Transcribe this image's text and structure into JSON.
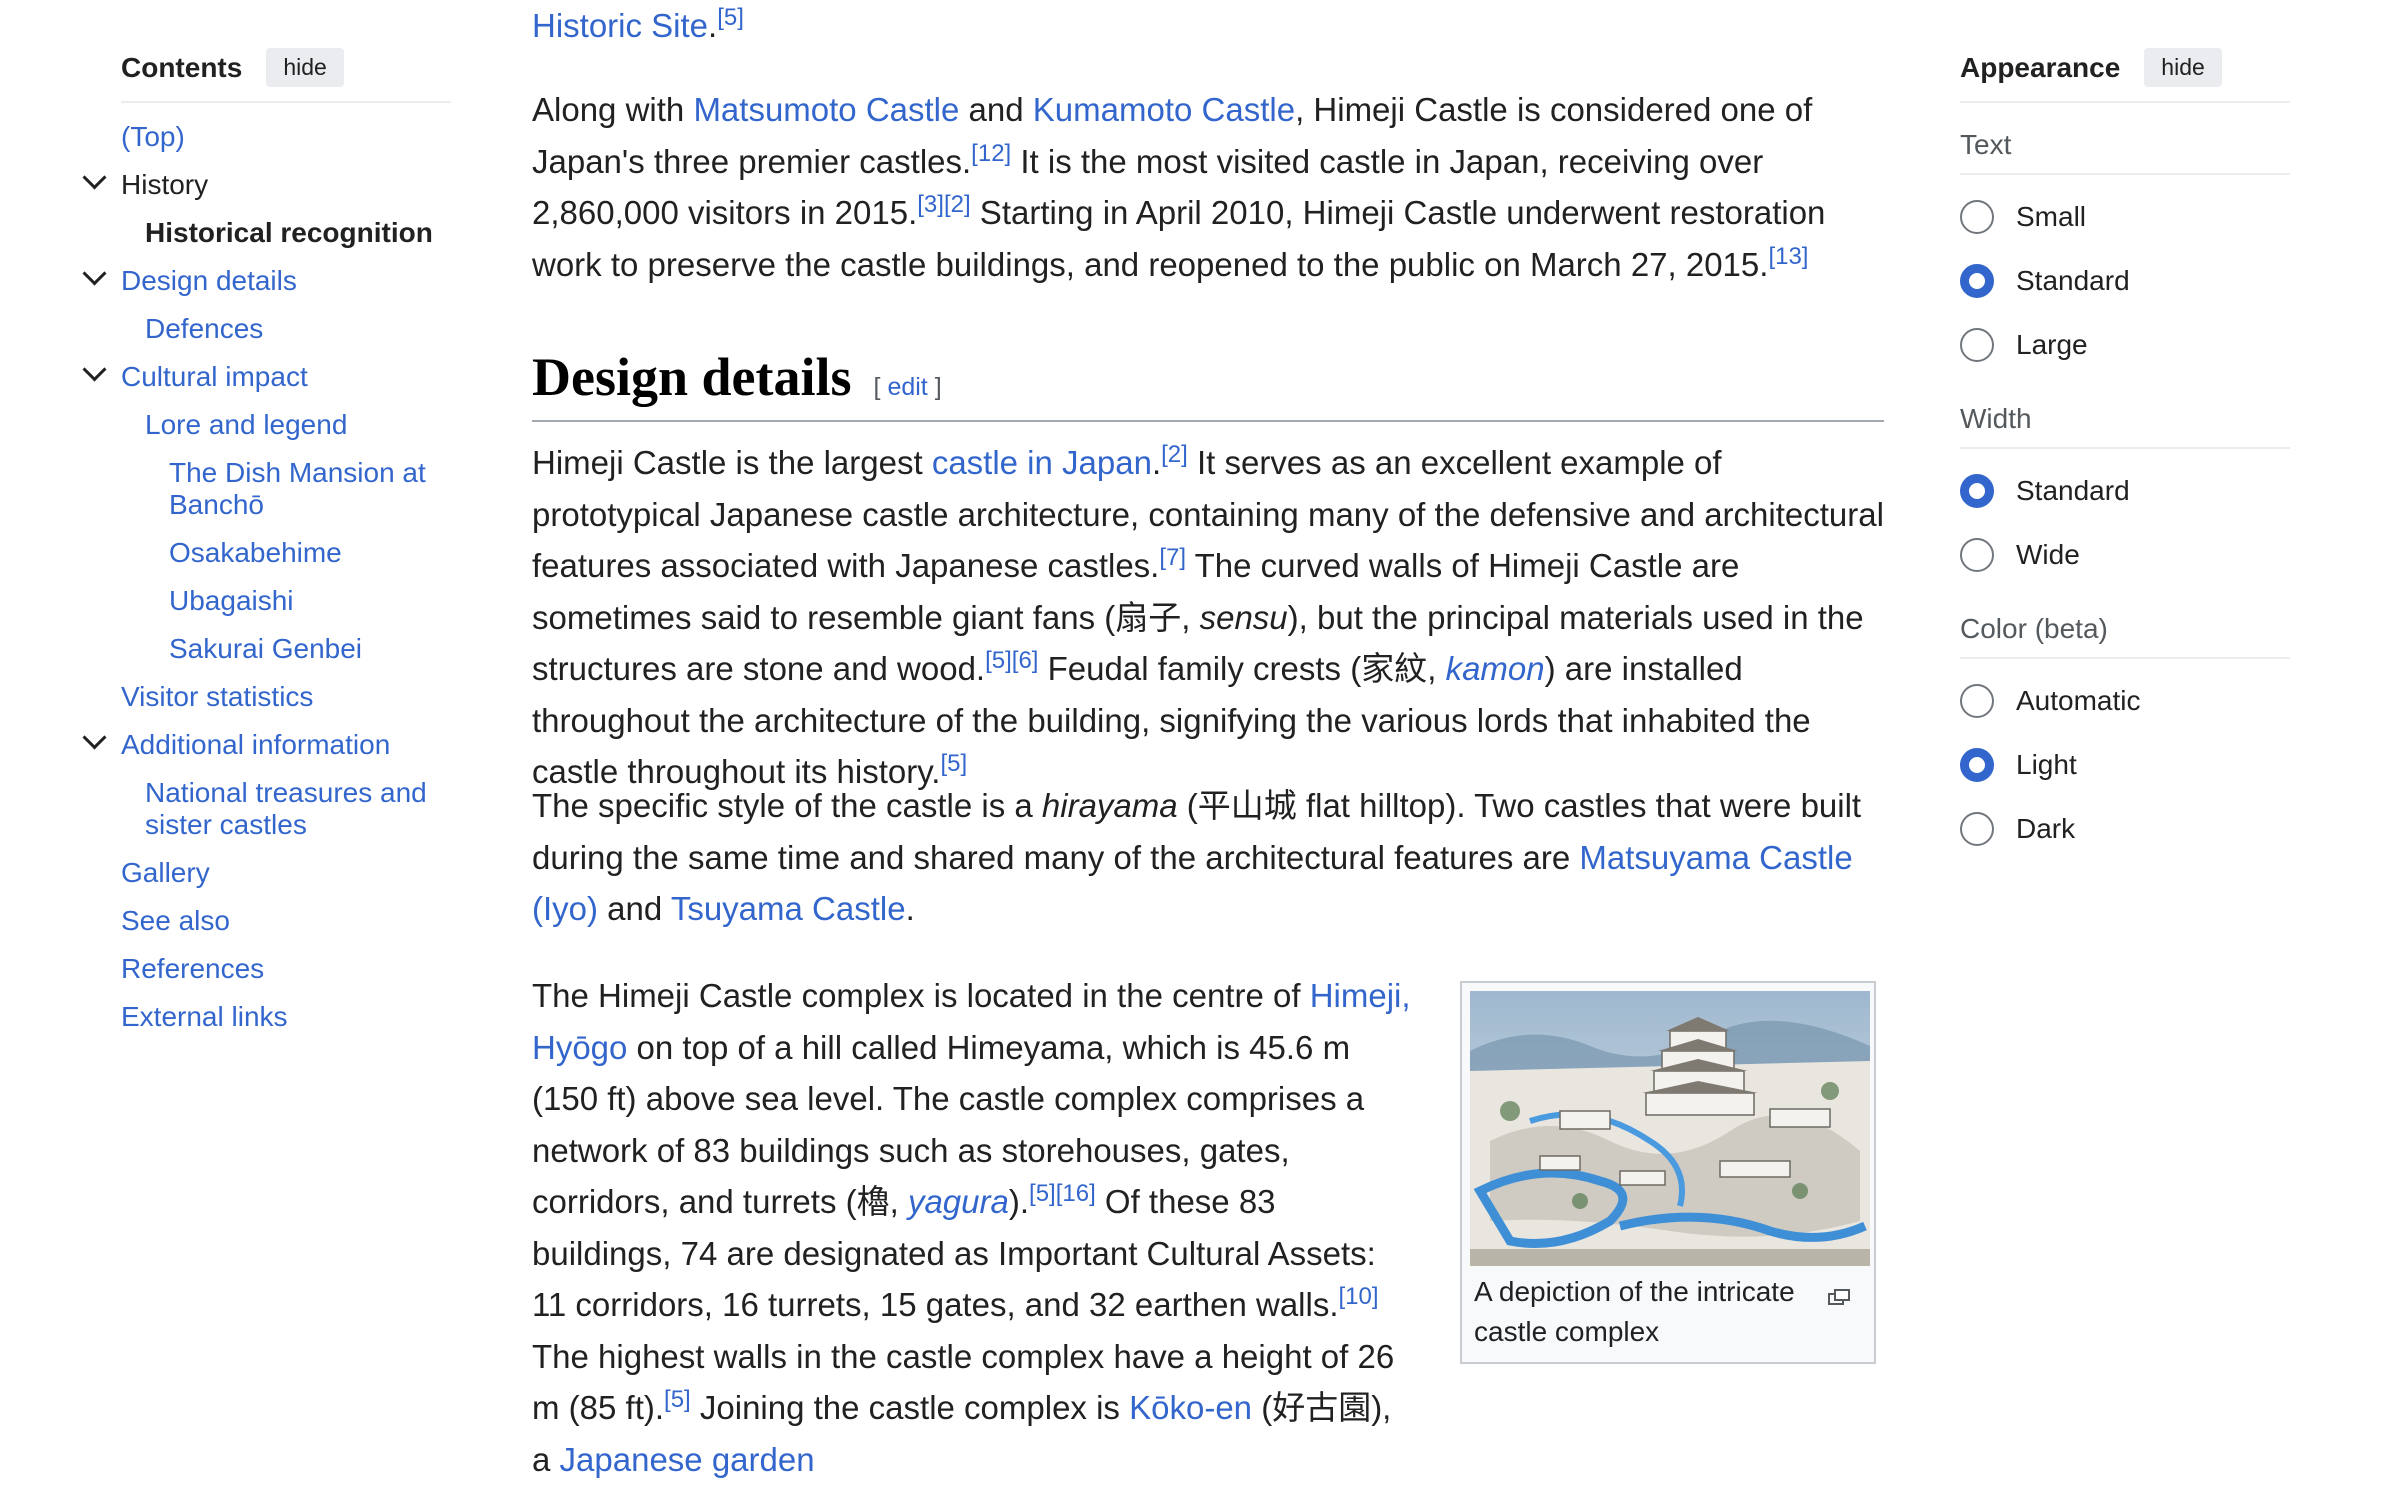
{
  "toc": {
    "title": "Contents",
    "hide_label": "hide",
    "items": [
      {
        "label": "(Top)",
        "level": 1
      },
      {
        "label": "History",
        "level": 1,
        "expanded": true
      },
      {
        "label": "Historical recognition",
        "level": 2,
        "active": true
      },
      {
        "label": "Design details",
        "level": 1,
        "expanded": true
      },
      {
        "label": "Defences",
        "level": 2
      },
      {
        "label": "Cultural impact",
        "level": 1,
        "expanded": true
      },
      {
        "label": "Lore and legend",
        "level": 2
      },
      {
        "label": "The Dish Mansion at Banchō",
        "level": 3
      },
      {
        "label": "Osakabehime",
        "level": 3
      },
      {
        "label": "Ubagaishi",
        "level": 3
      },
      {
        "label": "Sakurai Genbei",
        "level": 3
      },
      {
        "label": "Visitor statistics",
        "level": 1
      },
      {
        "label": "Additional information",
        "level": 1,
        "expanded": true
      },
      {
        "label": "National treasures and sister castles",
        "level": 2
      },
      {
        "label": "Gallery",
        "level": 1
      },
      {
        "label": "See also",
        "level": 1
      },
      {
        "label": "References",
        "level": 1
      },
      {
        "label": "External links",
        "level": 1
      }
    ]
  },
  "article": {
    "prev_tail": {
      "link": "Historic Site",
      "punct": ".",
      "ref": "[5]"
    },
    "p1": {
      "t1": "Along with ",
      "l1": "Matsumoto Castle",
      "t2": " and ",
      "l2": "Kumamoto Castle",
      "t3": ", Himeji Castle is considered one of Japan's three premier castles.",
      "r1": "[12]",
      "t4": " It is the most visited castle in Japan, receiving over 2,860,000 visitors in 2015.",
      "r2": "[3][2]",
      "t5": " Starting in April 2010, Himeji Castle underwent restoration work to preserve the castle buildings, and reopened to the public on March 27, 2015.",
      "r3": "[13]"
    },
    "heading": "Design details",
    "edit_open": "[ ",
    "edit_label": "edit",
    "edit_close": " ]",
    "p2": {
      "t1": "Himeji Castle is the largest ",
      "l1": "castle in Japan",
      "t2": ".",
      "r1": "[2]",
      "t3": " It serves as an excellent example of prototypical Japanese castle architecture, containing many of the defensive and architectural features associated with Japanese castles.",
      "r2": "[7]",
      "t4": " The curved walls of Himeji Castle are sometimes said to resemble giant fans (扇子, ",
      "i1": "sensu",
      "t5": "), but the principal materials used in the structures are stone and wood.",
      "r3": "[5][6]",
      "t6": " Feudal family crests (家紋, ",
      "l2": "kamon",
      "t7": ") are installed throughout the architecture of the building, signifying the various lords that inhabited the castle throughout its history.",
      "r4": "[5]"
    },
    "p3": {
      "t1": "The specific style of the castle is a ",
      "i1": "hirayama",
      "t2": " (平山城 flat hilltop). Two castles that were built during the same time and shared many of the architectural features are ",
      "l1": "Matsuyama Castle (Iyo)",
      "t3": " and ",
      "l2": "Tsuyama Castle",
      "t4": "."
    },
    "p4": {
      "t1": "The Himeji Castle complex is located in the centre of ",
      "l1": "Himeji, Hyōgo",
      "t2": " on top of a hill called Himeyama, which is 45.6 m (150 ft) above sea level. The castle complex comprises a network of 83 buildings such as storehouses, gates, corridors, and turrets (櫓, ",
      "l2": "yagura",
      "t3": ").",
      "r1": "[5][16]",
      "t4": " Of these 83 buildings, 74 are designated as Important Cultural Assets: 11 corridors, 16 turrets, 15 gates, and 32 earthen walls.",
      "r2": "[10]",
      "t5": " The highest walls in the castle complex have a height of 26 m (85 ft).",
      "r3": "[5]",
      "t6": " Joining the castle complex is ",
      "l3": "Kōko-en",
      "t7": " (好古園), a ",
      "l4": "Japanese garden"
    },
    "figure": {
      "caption": "A depiction of the intricate castle complex",
      "icon": "enlarge-icon"
    }
  },
  "appearance": {
    "title": "Appearance",
    "hide_label": "hide",
    "groups": [
      {
        "label": "Text",
        "options": [
          {
            "label": "Small",
            "checked": false
          },
          {
            "label": "Standard",
            "checked": true
          },
          {
            "label": "Large",
            "checked": false
          }
        ]
      },
      {
        "label": "Width",
        "options": [
          {
            "label": "Standard",
            "checked": true
          },
          {
            "label": "Wide",
            "checked": false
          }
        ]
      },
      {
        "label": "Color (beta)",
        "options": [
          {
            "label": "Automatic",
            "checked": false
          },
          {
            "label": "Light",
            "checked": true
          },
          {
            "label": "Dark",
            "checked": false
          }
        ]
      }
    ]
  },
  "colors": {
    "link": "#3366cc",
    "text": "#202122",
    "radio_checked": "#3366cc"
  }
}
